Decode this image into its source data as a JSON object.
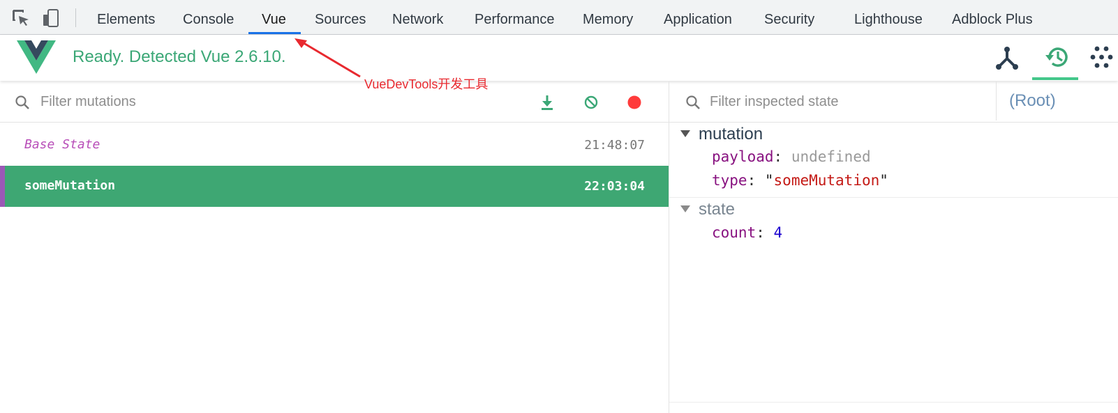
{
  "devtools": {
    "tabs": [
      "Elements",
      "Console",
      "Vue",
      "Sources",
      "Network",
      "Performance",
      "Memory",
      "Application",
      "Security",
      "Lighthouse",
      "Adblock Plus"
    ],
    "active_tab": "Vue"
  },
  "header": {
    "status": "Ready. Detected Vue 2.6.10.",
    "brand_color": "#42b883"
  },
  "annotation": {
    "text": "VueDevTools开发工具",
    "color": "#e8292f"
  },
  "mutations": {
    "filter_placeholder": "Filter mutations",
    "rows": [
      {
        "name": "Base State",
        "time": "21:48:07"
      },
      {
        "name": "someMutation",
        "time": "22:03:04"
      }
    ]
  },
  "inspector": {
    "filter_placeholder": "Filter inspected state",
    "root_label": "(Root)",
    "mutation_section": "mutation",
    "payload_key": "payload",
    "payload_value": "undefined",
    "type_key": "type",
    "type_value": "someMutation",
    "state_section": "state",
    "count_key": "count",
    "count_value": "4"
  }
}
